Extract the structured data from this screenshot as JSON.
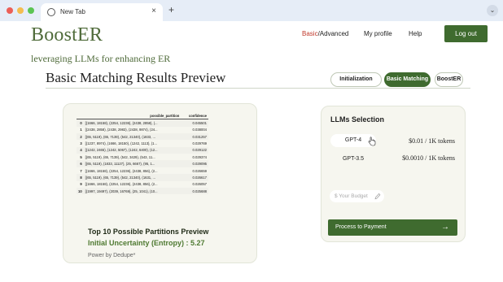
{
  "browser": {
    "tab_title": "New Tab",
    "tab_close": "×",
    "new_tab": "+",
    "menu": "⌄"
  },
  "header": {
    "brand": "BoostER",
    "tagline": "leveraging LLMs for enhancing ER",
    "nav_basic_accent": "Basic",
    "nav_basic_rest": "/Advanced",
    "nav_profile": "My profile",
    "nav_help": "Help",
    "logout": "Log out",
    "accent_color": "#3f6b2f"
  },
  "page": {
    "title": "Basic Matching Results Preview",
    "steps": [
      "Initialization",
      "Basic Matching",
      "BoostER"
    ],
    "active_step": "Basic Matching"
  },
  "preview": {
    "columns": [
      "possible_partition",
      "confidence"
    ],
    "rows": [
      {
        "idx": "0",
        "partition": "[(1666, 18158), (2254, 12236), (2438, 2858), (...",
        "confidence": "0.045501"
      },
      {
        "idx": "1",
        "partition": "[(2438, 2858), (2438, 2983), (2438, 9874), (24...",
        "confidence": "0.038004"
      },
      {
        "idx": "2",
        "partition": "[(65, 5119), (65, 7139), (542, 21340), (1833, ...",
        "confidence": "0.031257"
      },
      {
        "idx": "3",
        "partition": "[(1237, 8974), (1666, 18150), (1242, 1113), (1...",
        "confidence": "0.029769"
      },
      {
        "idx": "4",
        "partition": "[(1242, 2465), (1242, 5067), (1242, 6400), (12...",
        "confidence": "0.029122"
      },
      {
        "idx": "5",
        "partition": "[(65, 5119), (65, 7139), (542, 3429), (543, 11...",
        "confidence": "0.029374"
      },
      {
        "idx": "6",
        "partition": "[(65, 5119), (1833, 11127), (25, 6667), (95, 1...",
        "confidence": "0.029095"
      },
      {
        "idx": "7",
        "partition": "[(1666, 18158), (2254, 12236), (2438, 856), (2...",
        "confidence": "0.026659"
      },
      {
        "idx": "8",
        "partition": "[(65, 5119), (65, 7139), (542, 21340), (1631, ...",
        "confidence": "0.026617"
      },
      {
        "idx": "9",
        "partition": "[(1666, 18158), (2254, 12236), (2438, 856), (2...",
        "confidence": "0.026057"
      },
      {
        "idx": "10",
        "partition": "[(1997, 19497), (2039, 16769), (25, 1041), (10...",
        "confidence": "0.025688"
      }
    ],
    "heading": "Top 10 Possible Partitions Preview",
    "uncertainty_label": "Initial Uncertainty (Entropy) : ",
    "uncertainty_value": "5.27",
    "powered_by": "Power by Dedupe*"
  },
  "llm": {
    "title": "LLMs Selection",
    "models": [
      {
        "name": "GPT-4",
        "price": "$0.01 / 1K tokens",
        "selected": true
      },
      {
        "name": "GPT-3.5",
        "price": "$0.0010 / 1K tokens",
        "selected": false
      }
    ],
    "budget_placeholder": "$ Your Budget",
    "budget_icon": "pencil-icon",
    "pay_button": "Process to Payment",
    "pay_arrow": "→"
  }
}
